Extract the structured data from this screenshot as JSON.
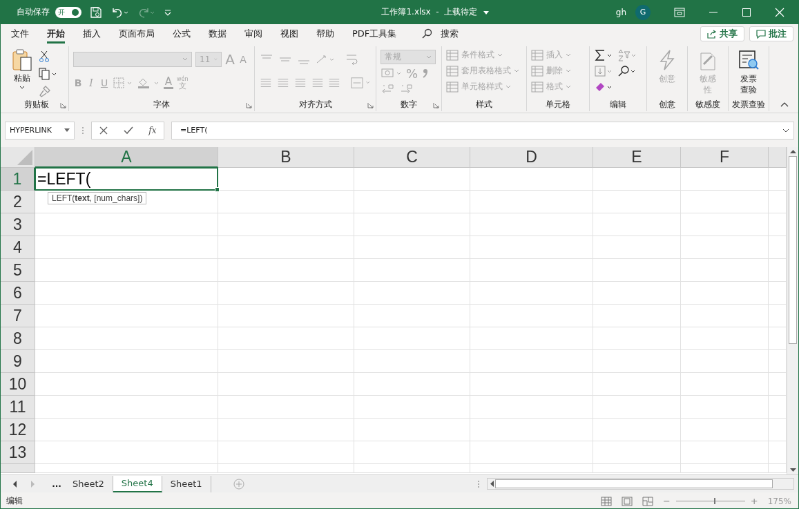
{
  "title_bar": {
    "autosave_label": "自动保存",
    "autosave": {
      "on": true,
      "label": "开"
    },
    "redo_disabled": true,
    "title": "工作簿1.xlsx  -  上载待定",
    "user": "gh",
    "avatar": "G"
  },
  "menu_tabs": [
    {
      "label": "文件",
      "selected": false
    },
    {
      "label": "开始",
      "selected": true
    },
    {
      "label": "插入",
      "selected": false
    },
    {
      "label": "页面布局",
      "selected": false
    },
    {
      "label": "公式",
      "selected": false
    },
    {
      "label": "数据",
      "selected": false
    },
    {
      "label": "审阅",
      "selected": false
    },
    {
      "label": "视图",
      "selected": false
    },
    {
      "label": "帮助",
      "selected": false
    },
    {
      "label": "PDF工具集",
      "selected": false
    }
  ],
  "search": {
    "label": "搜索"
  },
  "share_button": "共享",
  "comments_button": "批注",
  "ribbon": {
    "groups": [
      {
        "kind": "clipboard",
        "label": "剪贴板",
        "launcher": true,
        "disabled": false,
        "paste": "粘贴"
      },
      {
        "kind": "font",
        "label": "字体",
        "launcher": true,
        "disabled": true,
        "font_size": "11",
        "grow": "A",
        "shrink": "A",
        "styles": [
          "B",
          "I",
          "U"
        ],
        "font_color": "A",
        "phonetic_top": "wén",
        "phonetic_bottom": "文"
      },
      {
        "kind": "alignment",
        "label": "对齐方式",
        "launcher": true,
        "disabled": true
      },
      {
        "kind": "number",
        "label": "数字",
        "launcher": true,
        "disabled": true,
        "format": "常规",
        "percent": "%"
      },
      {
        "kind": "list",
        "label": "样式",
        "launcher": false,
        "disabled": true,
        "items": [
          "条件格式",
          "套用表格格式",
          "单元格样式"
        ]
      },
      {
        "kind": "list",
        "label": "单元格",
        "launcher": false,
        "disabled": true,
        "items": [
          "插入",
          "删除",
          "格式"
        ]
      },
      {
        "kind": "editing",
        "label": "编辑",
        "launcher": false,
        "disabled": false
      },
      {
        "kind": "big",
        "label": "创意",
        "launcher": false,
        "disabled": true,
        "button": "创意"
      },
      {
        "kind": "big",
        "label": "敏感度",
        "launcher": false,
        "disabled": true,
        "button": "敏感性"
      },
      {
        "kind": "big",
        "label": "发票查验",
        "launcher": false,
        "disabled": false,
        "button": "发票查验"
      }
    ]
  },
  "formula_bar": {
    "name_box": "HYPERLINK",
    "fx": "fx",
    "formula": "=LEFT("
  },
  "grid": {
    "columns": [
      {
        "label": "A",
        "selected": true
      },
      {
        "label": "B",
        "selected": false
      },
      {
        "label": "C",
        "selected": false
      },
      {
        "label": "D",
        "selected": false
      },
      {
        "label": "E",
        "selected": false
      },
      {
        "label": "F",
        "selected": false
      }
    ],
    "rows": [
      {
        "label": "1",
        "selected": true
      },
      {
        "label": "2",
        "selected": false
      },
      {
        "label": "3",
        "selected": false
      },
      {
        "label": "4",
        "selected": false
      },
      {
        "label": "5",
        "selected": false
      },
      {
        "label": "6",
        "selected": false
      },
      {
        "label": "7",
        "selected": false
      },
      {
        "label": "8",
        "selected": false
      },
      {
        "label": "9",
        "selected": false
      },
      {
        "label": "10",
        "selected": false
      },
      {
        "label": "11",
        "selected": false
      },
      {
        "label": "12",
        "selected": false
      },
      {
        "label": "13",
        "selected": false
      }
    ],
    "active_cell": {
      "value": "=LEFT(",
      "tooltip": "LEFT(**text**, [num_chars])"
    }
  },
  "sheets": {
    "more": "...",
    "tabs": [
      {
        "label": "Sheet2",
        "selected": false
      },
      {
        "label": "Sheet4",
        "selected": true
      },
      {
        "label": "Sheet1",
        "selected": false
      }
    ]
  },
  "status_bar": {
    "mode": "编辑",
    "zoom": {
      "minus": "−",
      "plus": "+",
      "level": 0.55,
      "reading": "175%"
    }
  }
}
